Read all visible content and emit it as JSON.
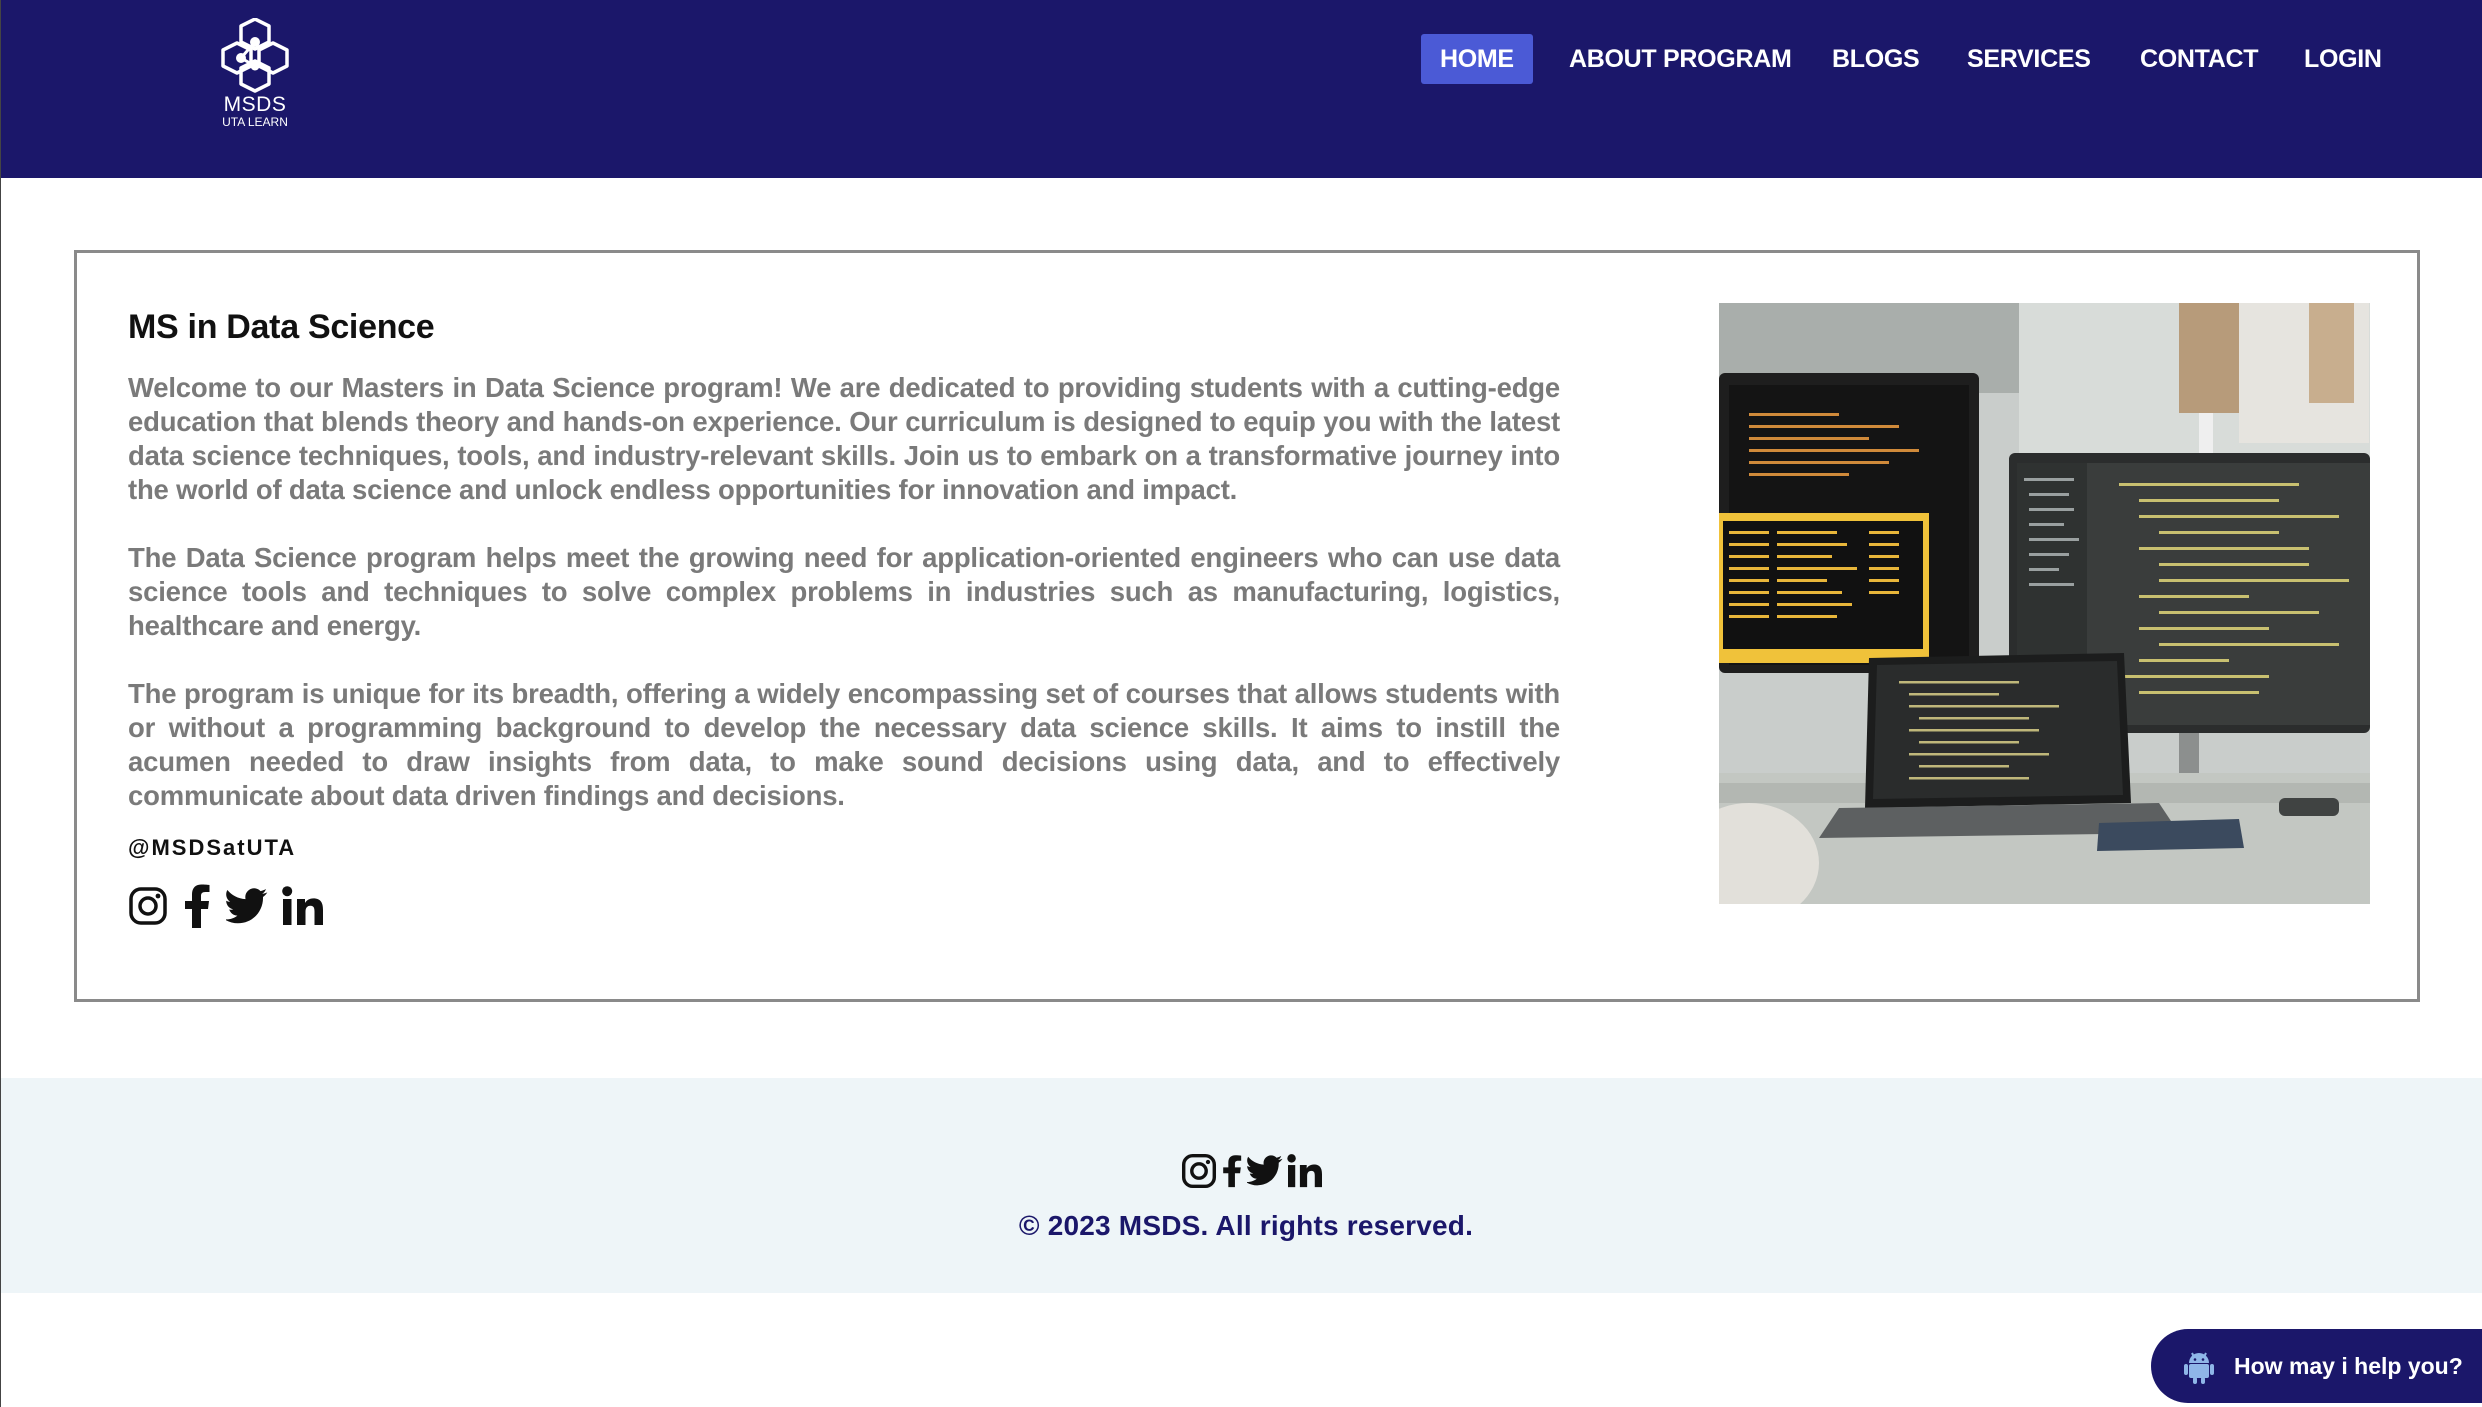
{
  "brand": {
    "logo_title": "MSDS",
    "logo_subtitle": "UTA LEARN"
  },
  "nav": {
    "items": [
      {
        "label": "HOME",
        "active": true
      },
      {
        "label": "ABOUT PROGRAM",
        "active": false
      },
      {
        "label": "BLOGS",
        "active": false
      },
      {
        "label": "SERVICES",
        "active": false
      },
      {
        "label": "CONTACT",
        "active": false
      },
      {
        "label": "LOGIN",
        "active": false
      }
    ]
  },
  "main": {
    "title": "MS in Data Science",
    "paragraphs": [
      "Welcome to our Masters in Data Science program! We are dedicated to providing students with a cutting-edge education that blends theory and hands-on experience. Our curriculum is designed to equip you with the latest data science techniques, tools, and industry-relevant skills. Join us to embark on a transformative journey into the world of data science and unlock endless opportunities for innovation and impact.",
      "The Data Science program helps meet the growing need for application-oriented engineers who can use data science tools and techniques to solve complex problems in industries such as manufacturing, logistics, healthcare and energy.",
      "The program is unique for its breadth, offering a widely encompassing set of courses that allows students with or without a programming background to develop the necessary data science skills. It aims to instill the acumen needed to draw insights from data, to make sound decisions using data, and to effectively communicate about data driven findings and decisions."
    ],
    "handle": "@MSDSatUTA",
    "social_icons": [
      "instagram-icon",
      "facebook-icon",
      "twitter-icon",
      "linkedin-icon"
    ]
  },
  "footer": {
    "social_icons": [
      "instagram-icon",
      "facebook-icon",
      "twitter-icon",
      "linkedin-icon"
    ],
    "copyright": "© 2023 MSDS. All rights reserved."
  },
  "chat": {
    "label": "How may i help you?"
  },
  "colors": {
    "navbar_bg": "#1b176a",
    "nav_active_bg": "#4b5ad6",
    "paragraph_text": "#7a7a7a",
    "footer_bg": "#eef5f8",
    "card_border": "#8a8a8a"
  }
}
